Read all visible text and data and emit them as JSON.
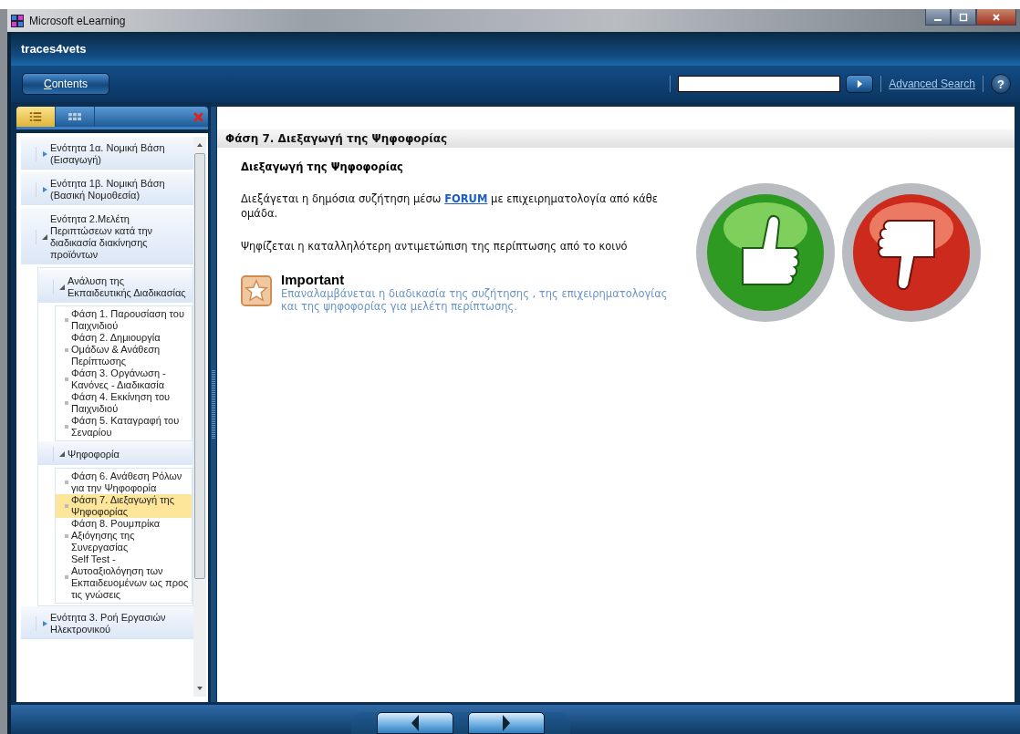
{
  "window": {
    "title": "Microsoft eLearning"
  },
  "app": {
    "title": "traces4vets"
  },
  "toolbar": {
    "contents_button": "Contents",
    "advanced_search": "Advanced Search",
    "help": "?"
  },
  "sidebar": {
    "view_tabs": [
      {
        "kind": "list",
        "selected": true
      },
      {
        "kind": "grid",
        "selected": false
      }
    ],
    "tree": [
      {
        "label": "Ενότητα 1α. Νομική Βάση (Εισαγωγή)",
        "expanded": false,
        "selected": false
      },
      {
        "label": "Ενότητα 1β. Νομική Βάση (Βασική Νομοθεσία)",
        "expanded": false,
        "selected": false
      },
      {
        "label": "Ενότητα 2.Μελέτη Περιπτώσεων κατά την διαδικασία διακίνησης προϊόντων",
        "expanded": true,
        "selected": false,
        "children": [
          {
            "label": "Ανάλυση της Εκπαιδευτικής Διαδικασίας",
            "expanded": true,
            "selected": false,
            "children": [
              {
                "label": "Φάση 1. Παρουσίαση του Παιχνιδιού",
                "selected": false
              },
              {
                "label": "Φάση 2. Δημιουργία Ομάδων & Ανάθεση Περίπτωσης",
                "selected": false
              },
              {
                "label": "Φάση 3. Οργάνωση - Κανόνες - Διαδικασία",
                "selected": false
              },
              {
                "label": "Φάση 4. Εκκίνηση του Παιχνιδιού",
                "selected": false
              },
              {
                "label": "Φάση 5. Καταγραφή του Σεναρίου",
                "selected": false
              }
            ]
          },
          {
            "label": "Ψηφοφορία",
            "expanded": true,
            "selected": false,
            "children": [
              {
                "label": "Φάση 6. Ανάθεση Ρόλων για την Ψηφοφορία",
                "selected": false
              },
              {
                "label": "Φάση 7. Διεξαγωγή της Ψηφοφορίας",
                "selected": true
              },
              {
                "label": "Φάση 8. Ρουμπρίκα Αξιόγησης της Συνεργασίας",
                "selected": false
              },
              {
                "label": "Self Test - Αυτοαξιολόγηση των Εκπαιδευομένων ως προς τις γνώσεις",
                "selected": false
              }
            ]
          }
        ]
      },
      {
        "label": "Ενότητα 3. Ροή Εργασιών Ηλεκτρονικού",
        "expanded": false,
        "selected": false
      }
    ]
  },
  "content": {
    "page_title": "Φάση 7. Διεξαγωγή της Ψηφοφορίας",
    "heading": "Διεξαγωγή της Ψηφοφορίας",
    "paragraphs": [
      {
        "before": "Διεξάγεται η δημόσια συζήτηση μέσω ",
        "link": "FORUM",
        "after": " με επιχειρηματολογία από κάθε ομάδα."
      },
      {
        "before": "Ψηφίζεται η καταλληλότερη αντιμετώπιση της περίπτωσης από το κοινό"
      }
    ],
    "important": {
      "title": "Important",
      "text": "Επαναλαμβάνεται η διαδικασία της συζήτησης , της επιχειρηματολογίας και της ψηφοφορίας για μελέτη περίπτωσης."
    }
  }
}
